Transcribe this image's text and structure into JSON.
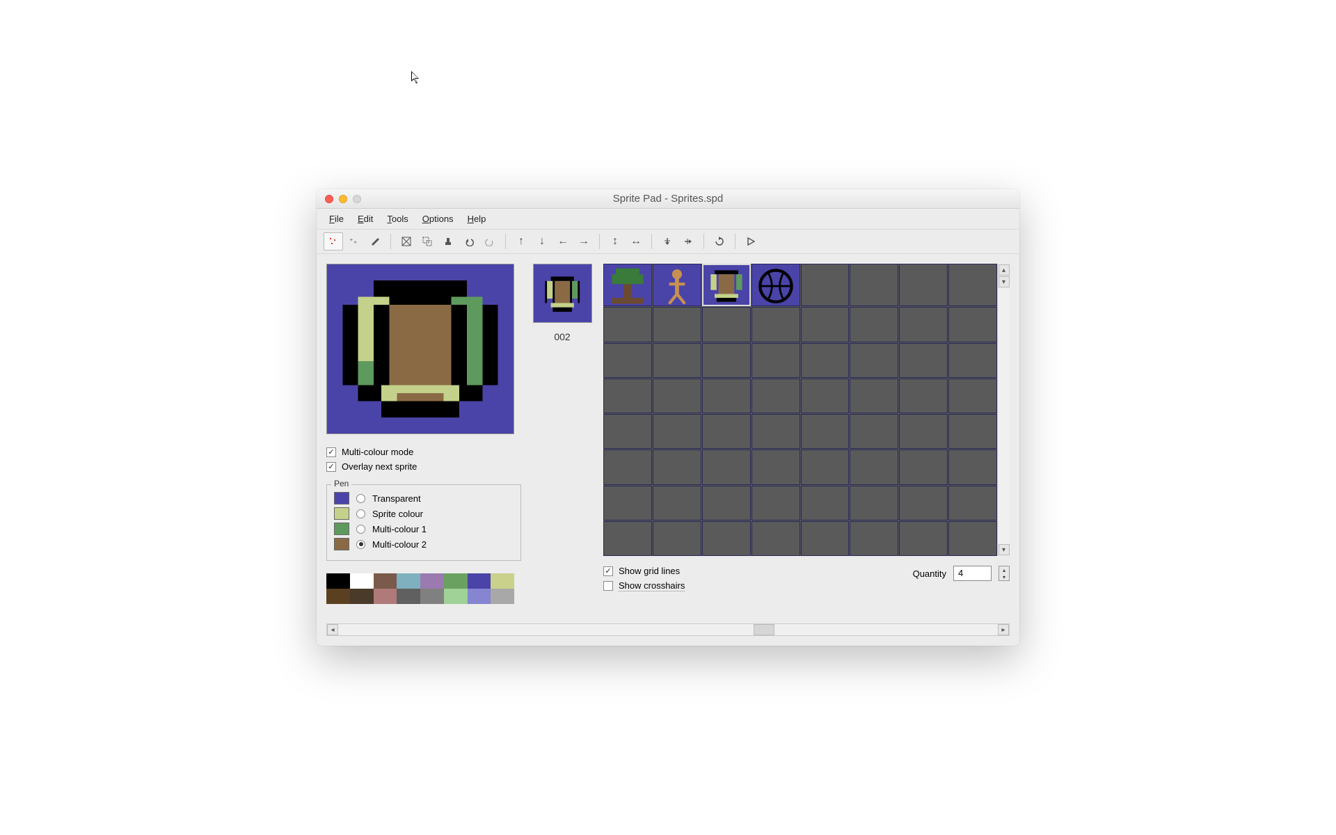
{
  "window": {
    "title": "Sprite Pad - Sprites.spd"
  },
  "menu": {
    "file": "File",
    "edit": "Edit",
    "tools": "Tools",
    "options": "Options",
    "help": "Help"
  },
  "toolbar": {
    "icons": [
      "pixel",
      "add-point",
      "fill",
      "x-box",
      "select",
      "stamp",
      "undo",
      "redo",
      "up",
      "down",
      "left",
      "right",
      "flip-v",
      "flip-h",
      "move-down",
      "move-right",
      "rotate",
      "play"
    ]
  },
  "preview": {
    "number": "002"
  },
  "checkboxes": {
    "multi_colour": {
      "label": "Multi-colour mode",
      "checked": true
    },
    "overlay": {
      "label": "Overlay next sprite",
      "checked": true
    }
  },
  "pen": {
    "title": "Pen",
    "items": [
      {
        "label": "Transparent",
        "color": "#4a44a8",
        "selected": false
      },
      {
        "label": "Sprite colour",
        "color": "#c4d18a",
        "selected": false
      },
      {
        "label": "Multi-colour 1",
        "color": "#5e9a5e",
        "selected": false
      },
      {
        "label": "Multi-colour 2",
        "color": "#8a6a45",
        "selected": true
      }
    ]
  },
  "palette": [
    "#000000",
    "#ffffff",
    "#7a5a4a",
    "#7fb0bf",
    "#9a7aaf",
    "#6aa060",
    "#4a44a8",
    "#c9d18a",
    "#5a4020",
    "#4a3a2a",
    "#b07a7a",
    "#606060",
    "#808080",
    "#a0d197",
    "#8585d1",
    "#a8a8a8"
  ],
  "grid": {
    "show_grid": {
      "label": "Show grid lines",
      "checked": true
    },
    "show_crosshairs": {
      "label": "Show crosshairs",
      "checked": false
    },
    "quantity_label": "Quantity",
    "quantity_value": "4"
  },
  "sprites": {
    "selected_index": 2,
    "cells": [
      {
        "type": "tree"
      },
      {
        "type": "person"
      },
      {
        "type": "acorn"
      },
      {
        "type": "outline"
      }
    ]
  }
}
